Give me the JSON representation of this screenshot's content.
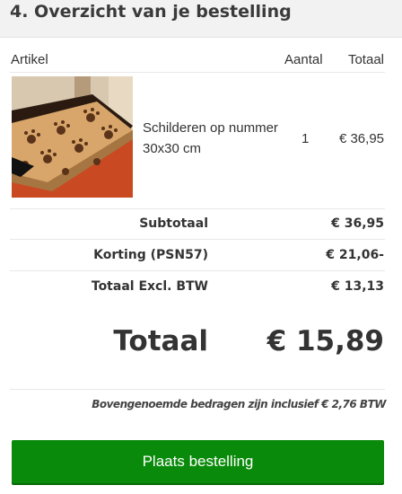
{
  "section": {
    "title": "4. Overzicht van je bestelling"
  },
  "table": {
    "headers": {
      "article": "Artikel",
      "quantity": "Aantal",
      "total": "Totaal"
    },
    "items": [
      {
        "name": "Schilderen op nummer 30x30 cm",
        "quantity": "1",
        "total": "€ 36,95"
      }
    ]
  },
  "summary": {
    "subtotal_label": "Subtotaal",
    "subtotal_value": "€ 36,95",
    "discount_label": "Korting (PSN57)",
    "discount_value": "€ 21,06-",
    "excl_label": "Totaal Excl. BTW",
    "excl_value": "€ 13,13",
    "total_label": "Totaal",
    "total_value": "€ 15,89",
    "vat_note": "Bovengenoemde bedragen zijn inclusief € 2,76 BTW"
  },
  "actions": {
    "place_order_label": "Plaats bestelling"
  },
  "colors": {
    "button": "#0a8a0a",
    "header_bg": "#f2f2f2"
  }
}
